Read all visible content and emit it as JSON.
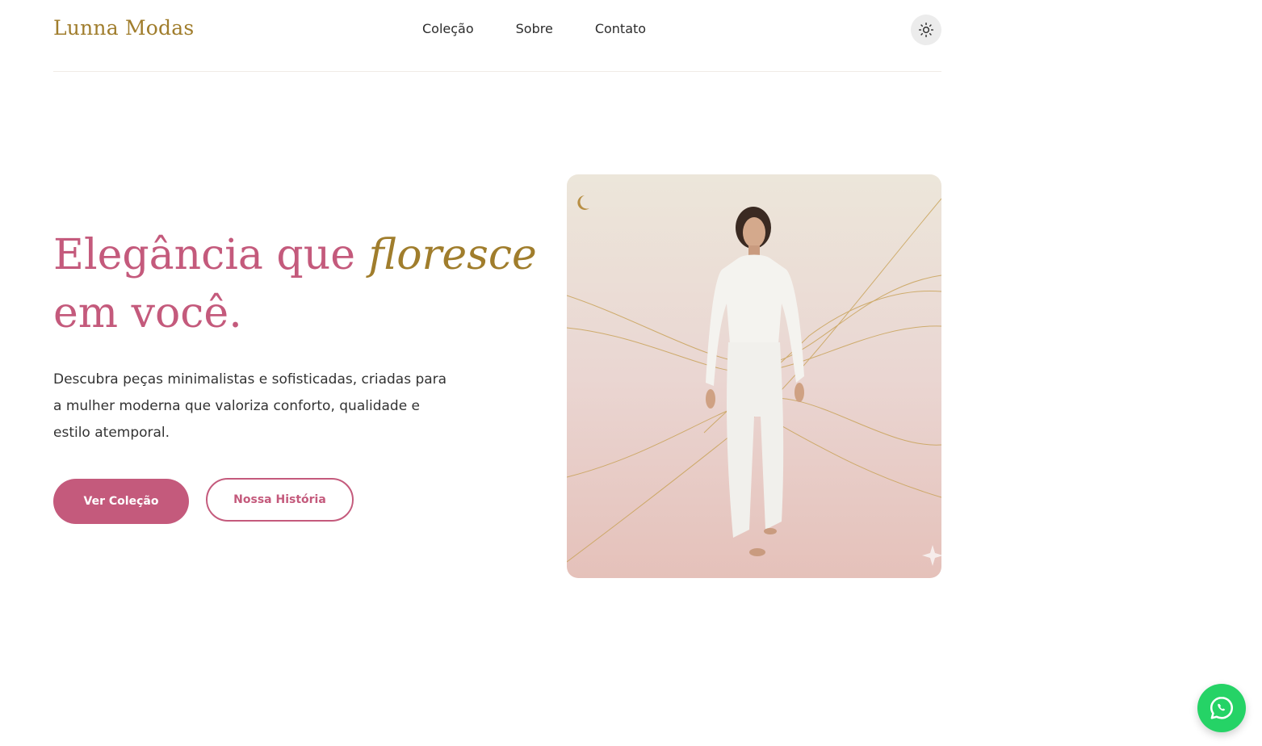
{
  "header": {
    "logo": "Lunna Modas",
    "nav": [
      "Coleção",
      "Sobre",
      "Contato"
    ],
    "theme_toggle_icon": "sun-icon"
  },
  "hero": {
    "title_part1": "Elegância que ",
    "title_accent": "floresce",
    "title_part2": "em você.",
    "description": "Descubra peças minimalistas e sofisticadas, criadas para a mulher moderna que valoriza conforto, qualidade e estilo atemporal.",
    "primary_button": "Ver Coleção",
    "secondary_button": "Nossa História",
    "image": {
      "subject": "model-in-white-outfit",
      "icons": [
        "moon-icon",
        "sparkle-icon"
      ]
    }
  },
  "floating": {
    "whatsapp_icon": "whatsapp-icon"
  },
  "colors": {
    "brand_pink": "#c45a7c",
    "brand_gold": "#a07d2c",
    "whatsapp_green": "#25d366"
  }
}
